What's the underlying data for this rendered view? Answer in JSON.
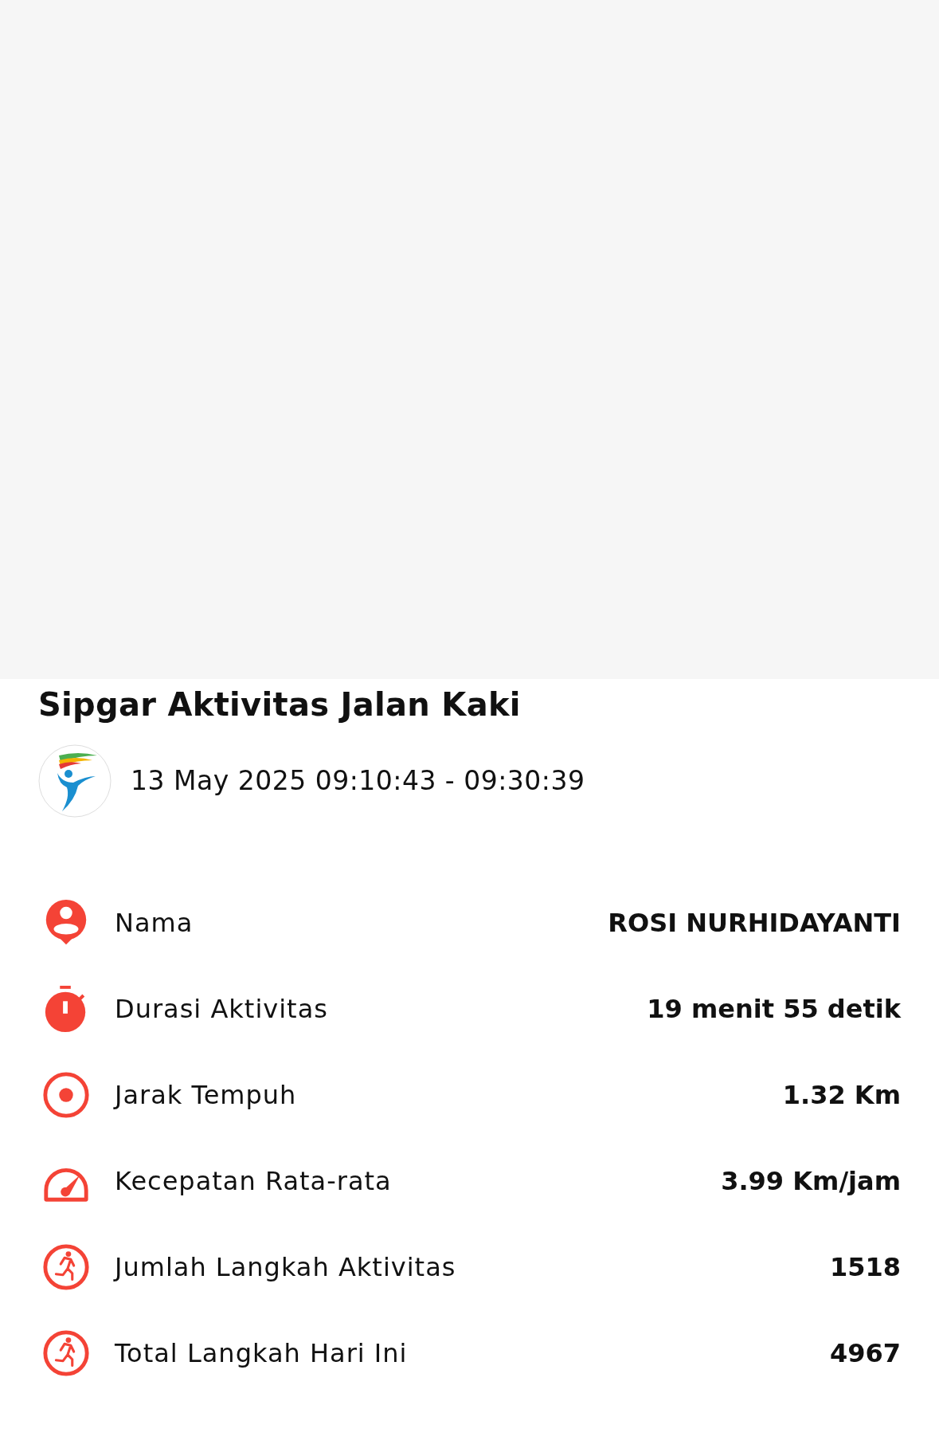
{
  "title": "Sipgar Aktivitas Jalan Kaki",
  "datetime": "13 May 2025 09:10:43 - 09:30:39",
  "rows": [
    {
      "kind": "person",
      "label": "Nama",
      "value": "ROSI NURHIDAYANTI"
    },
    {
      "kind": "timer",
      "label": "Durasi Aktivitas",
      "value": "19 menit 55 detik"
    },
    {
      "kind": "target",
      "label": "Jarak Tempuh",
      "value": "1.32 Km"
    },
    {
      "kind": "gauge",
      "label": "Kecepatan Rata-rata",
      "value": "3.99 Km/jam"
    },
    {
      "kind": "steps",
      "label": "Jumlah Langkah Aktivitas",
      "value": "1518"
    },
    {
      "kind": "steps",
      "label": "Total Langkah Hari Ini",
      "value": "4967"
    }
  ]
}
